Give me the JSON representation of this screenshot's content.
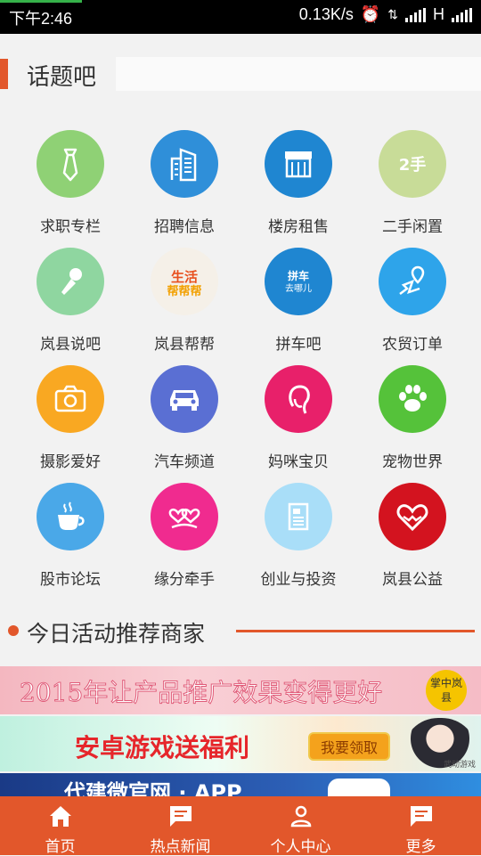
{
  "status_bar": {
    "time": "下午2:46",
    "speed": "0.13K/s",
    "network": "H"
  },
  "section": {
    "title": "话题吧"
  },
  "topics": [
    {
      "label": "求职专栏",
      "icon": "tie-icon",
      "color": "#8fd175"
    },
    {
      "label": "招聘信息",
      "icon": "building-icon",
      "color": "#2f8fd9"
    },
    {
      "label": "楼房租售",
      "icon": "storefront-icon",
      "color": "#1f86d1"
    },
    {
      "label": "二手闲置",
      "icon": "secondhand-icon",
      "color": "#c8dc98"
    },
    {
      "label": "岚县说吧",
      "icon": "microphone-icon",
      "color": "#8fd6a0"
    },
    {
      "label": "岚县帮帮",
      "icon": "life-help-logo-icon",
      "color": "#f5f0e8"
    },
    {
      "label": "拼车吧",
      "icon": "carpool-icon",
      "color": "#1f86d1"
    },
    {
      "label": "农贸订单",
      "icon": "map-route-icon",
      "color": "#2ea4ea"
    },
    {
      "label": "摄影爱好",
      "icon": "camera-icon",
      "color": "#f9a822"
    },
    {
      "label": "汽车频道",
      "icon": "car-icon",
      "color": "#5a6fd3"
    },
    {
      "label": "妈咪宝贝",
      "icon": "mother-icon",
      "color": "#e8206a"
    },
    {
      "label": "宠物世界",
      "icon": "paw-icon",
      "color": "#55c23a"
    },
    {
      "label": "股市论坛",
      "icon": "coffee-cup-icon",
      "color": "#4aa8e8"
    },
    {
      "label": "缘分牵手",
      "icon": "hearts-icon",
      "color": "#f02b8f"
    },
    {
      "label": "创业与投资",
      "icon": "document-icon",
      "color": "#a9def8"
    },
    {
      "label": "岚县公益",
      "icon": "heart-hands-icon",
      "color": "#d3131f"
    }
  ],
  "recommend": {
    "title": "今日活动推荐商家"
  },
  "banners": [
    {
      "text": "2015年让产品推广效果变得更好",
      "badge": "掌中岚县"
    },
    {
      "text": "安卓游戏送福利",
      "cta": "我要领取",
      "caption": "武动游戏"
    },
    {
      "text": "代建微官网 · APP"
    }
  ],
  "tabs": [
    {
      "label": "首页",
      "icon": "home-icon"
    },
    {
      "label": "热点新闻",
      "icon": "chat-icon"
    },
    {
      "label": "个人中心",
      "icon": "person-icon"
    },
    {
      "label": "更多",
      "icon": "chat-more-icon"
    }
  ],
  "colors": {
    "accent": "#e2572b"
  }
}
